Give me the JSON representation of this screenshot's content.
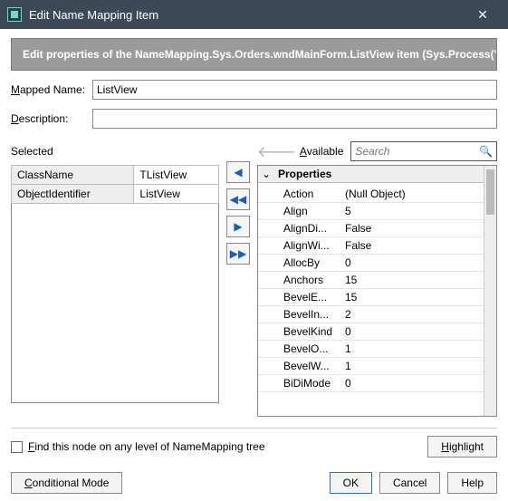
{
  "window": {
    "title": "Edit Name Mapping Item",
    "close_glyph": "✕"
  },
  "banner": "Edit properties of the NameMapping.Sys.Orders.wndMainForm.ListView item (Sys.Process(\"O",
  "fields": {
    "mapped_name_label_pre": "",
    "mapped_name_u": "M",
    "mapped_name_label_post": "apped Name:",
    "mapped_name_value": "ListView",
    "description_u": "D",
    "description_label_post": "escription:",
    "description_value": ""
  },
  "sections": {
    "selected_label": "Selected",
    "available_pre": "",
    "available_u": "A",
    "available_post": "vailable",
    "search_placeholder": "Search",
    "back_glyph": "🡐",
    "mag_glyph": "🔍"
  },
  "selected_rows": [
    {
      "k": "ClassName",
      "v": "TListView"
    },
    {
      "k": "ObjectIdentifier",
      "v": "ListView"
    }
  ],
  "move_glyphs": {
    "left": "◀",
    "dbl_left": "◀◀",
    "right": "▶",
    "dbl_right": "▶▶"
  },
  "tree": {
    "root_label": "Properties",
    "twisty": "⌄",
    "rows": [
      {
        "k": "Action",
        "v": "(Null Object)"
      },
      {
        "k": "Align",
        "v": "5"
      },
      {
        "k": "AlignDi...",
        "v": "False"
      },
      {
        "k": "AlignWi...",
        "v": "False"
      },
      {
        "k": "AllocBy",
        "v": "0"
      },
      {
        "k": "Anchors",
        "v": "15"
      },
      {
        "k": "BevelE...",
        "v": "15"
      },
      {
        "k": "BevelIn...",
        "v": "2"
      },
      {
        "k": "BevelKind",
        "v": "0"
      },
      {
        "k": "BevelO...",
        "v": "1"
      },
      {
        "k": "BevelW...",
        "v": "1"
      },
      {
        "k": "BiDiMode",
        "v": "0"
      }
    ]
  },
  "options": {
    "find_pre": "",
    "find_u": "F",
    "find_post": "ind this node on any level of NameMapping tree",
    "highlight_u": "H",
    "highlight_post": "ighlight"
  },
  "footer": {
    "conditional_u": "C",
    "conditional_post": "onditional Mode",
    "ok": "OK",
    "cancel": "Cancel",
    "help": "Help"
  }
}
